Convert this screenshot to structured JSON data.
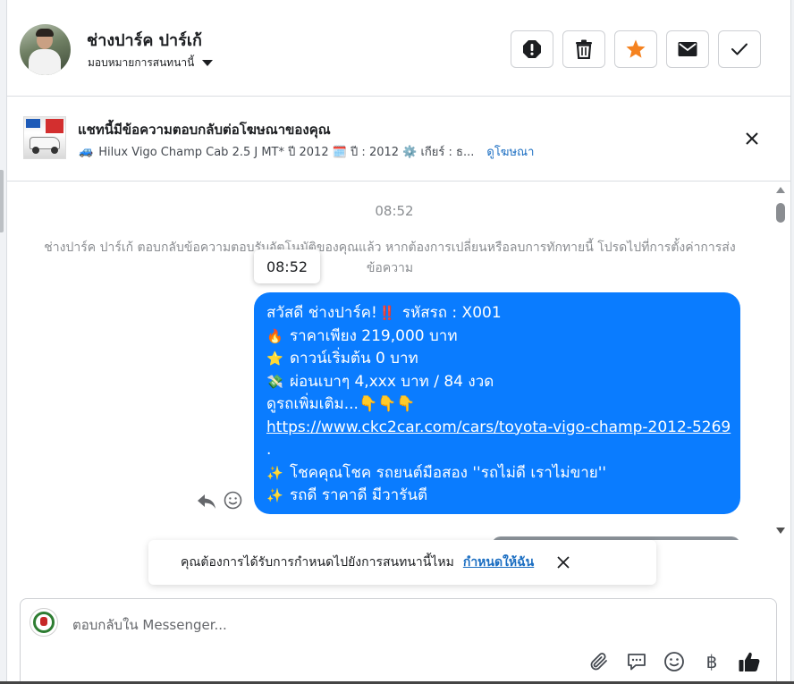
{
  "header": {
    "contact_name": "ช่างปาร์ค ปาร์เก้",
    "assign_label": "มอบหมายการสนทนานี้",
    "actions": [
      {
        "name": "mark-spam-button",
        "icon": "exclamation-octagon-icon"
      },
      {
        "name": "delete-button",
        "icon": "trash-icon"
      },
      {
        "name": "star-button",
        "icon": "star-icon"
      },
      {
        "name": "mark-unread-button",
        "icon": "envelope-icon"
      },
      {
        "name": "mark-done-button",
        "icon": "checkmark-icon"
      }
    ]
  },
  "ad": {
    "title": "แชทนี้มีข้อความตอบกลับต่อโฆษณาของคุณ",
    "desc_emoji": "🚙",
    "desc_text": "Hilux Vigo Champ Cab 2.5 J MT* ปี 2012 🗓️ ปี : 2012 ⚙️ เกียร์ : ธ...",
    "link": "ดูโฆษณา"
  },
  "chat": {
    "time_divider": "08:52",
    "system_message": "ช่างปาร์ค ปาร์เก้ ตอบกลับข้อความตอบรับอัตโนมัติของคุณแล้ว หากต้องการเปลี่ยนหรือลบการทักทายนี้ โปรดไปที่การตั้งค่าการส่งข้อความ",
    "tooltip_time": "08:52",
    "message": {
      "line1_text": "สวัสดี ช่างปาร์ค!",
      "line1_emoji": "‼️",
      "line1_tail": " รหัสรถ : X001",
      "line2_emoji": "🔥",
      "line2_text": "ราคาเพียง 219,000 บาท",
      "line3_emoji": "⭐",
      "line3_text": "ดาวน์เริ่มต้น 0 บาท",
      "line4_emoji": "💸",
      "line4_text": "ผ่อนเบาๆ 4,xxx บาท / 84 งวด",
      "line5_text": "ดูรถเพิ่มเติม...👇👇👇",
      "link": "https://www.ckc2car.com/cars/toyota-vigo-champ-2012-5269",
      "dot": ".",
      "line7_emoji": "✨",
      "line7_text": "โชคคุณโชค รถยนต์มือสอง ''รถไม่ดี เราไม่ขาย''",
      "line8_emoji": "✨",
      "line8_text": "รถดี ราคาดี มีวารันตี"
    }
  },
  "assign_prompt": {
    "text": "คุณต้องการได้รับการกำหนดไปยังการสนทนานี้ไหม",
    "link": "กำหนดให้ฉัน"
  },
  "composer": {
    "placeholder": "ตอบกลับใน Messenger...",
    "baht_symbol": "฿"
  },
  "colors": {
    "bubble": "#0a7cff",
    "star": "#f5821f",
    "link": "#1b6ec2"
  }
}
